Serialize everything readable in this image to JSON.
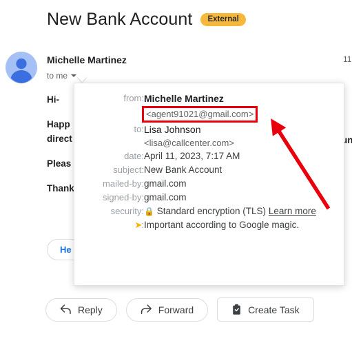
{
  "header": {
    "subject": "New Bank Account",
    "badge": "External"
  },
  "message": {
    "sender_name": "Michelle Martinez",
    "recipients": "to me",
    "timestamp": "11",
    "body_lines": [
      "Hi-",
      "Happ…\ndirect…",
      "Pleas…",
      "Thank…"
    ],
    "body_p1": "Hi-",
    "body_p2a": "Happ",
    "body_p2b": "direct",
    "body_p3": "Pleas",
    "body_p4": "Thank",
    "body_right_fragment": "un",
    "inline_button": "He"
  },
  "details": {
    "rows": [
      {
        "label": "from:",
        "name": "Michelle Martinez",
        "email": "<agent91021@gmail.com>"
      },
      {
        "label": "to:",
        "name": "Lisa Johnson",
        "email": "<lisa@callcenter.com>"
      },
      {
        "label": "date:",
        "value": "April 11, 2023, 7:17 AM"
      },
      {
        "label": "subject:",
        "value": "New Bank Account"
      },
      {
        "label": "mailed-by:",
        "value": "gmail.com"
      },
      {
        "label": "signed-by:",
        "value": "gmail.com"
      },
      {
        "label": "security:",
        "value": "Standard encryption (TLS)",
        "link": "Learn more"
      },
      {
        "label": ":",
        "value": "Important according to Google magic."
      }
    ],
    "from_label": "from:",
    "from_name": "Michelle Martinez",
    "from_email": "<agent91021@gmail.com>",
    "to_label": "to:",
    "to_name": "Lisa Johnson",
    "to_email": "<lisa@callcenter.com>",
    "date_label": "date:",
    "date_value": "April 11, 2023, 7:17 AM",
    "subject_label": "subject:",
    "subject_value": "New Bank Account",
    "mailed_by_label": "mailed-by:",
    "mailed_by_value": "gmail.com",
    "signed_by_label": "signed-by:",
    "signed_by_value": "gmail.com",
    "security_label": "security:",
    "security_value": "Standard encryption (TLS)",
    "security_link": "Learn more",
    "importance_label": ":",
    "importance_value": "Important according to Google magic."
  },
  "actions": [
    {
      "label": "Reply",
      "icon": "reply-arrow-icon"
    },
    {
      "label": "Forward",
      "icon": "forward-arrow-icon"
    },
    {
      "label": "Create Task",
      "icon": "clipboard-icon"
    }
  ],
  "action_reply": "Reply",
  "action_forward": "Forward",
  "action_create_task": "Create Task",
  "annotation": {
    "highlight_color": "#e8000d",
    "target": "<agent91021@gmail.com>"
  },
  "colors": {
    "badge_bg": "#f5b83d",
    "avatar_bg": "#a4c0f4",
    "avatar_fg": "#3b6fe0",
    "link_blue": "#1a73e8",
    "annotation_red": "#e8000d",
    "importance_yellow": "#f4b400"
  }
}
